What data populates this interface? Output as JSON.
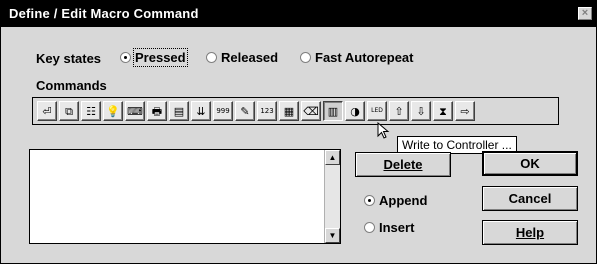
{
  "window": {
    "title": "Define / Edit Macro Command",
    "close_glyph": "×"
  },
  "key_states": {
    "label": "Key states",
    "options": [
      {
        "label": "Pressed",
        "selected": true
      },
      {
        "label": "Released",
        "selected": false
      },
      {
        "label": "Fast Autorepeat",
        "selected": false
      }
    ]
  },
  "commands": {
    "label": "Commands",
    "toolbar": [
      {
        "icon": "enter-icon",
        "glyph": "⏎"
      },
      {
        "icon": "copy-window-icon",
        "glyph": "⧉"
      },
      {
        "icon": "list-code-icon",
        "glyph": "☷"
      },
      {
        "icon": "light-bulb-icon",
        "glyph": "💡"
      },
      {
        "icon": "keyboard-icon",
        "glyph": "⌨"
      },
      {
        "icon": "printer-icon",
        "glyph": "🖶"
      },
      {
        "icon": "document-icon",
        "glyph": "▤"
      },
      {
        "icon": "sort-list-icon",
        "glyph": "⇊"
      },
      {
        "icon": "counter-999-icon",
        "glyph": "999"
      },
      {
        "icon": "pen-edit-icon",
        "glyph": "✎"
      },
      {
        "icon": "number-123-icon",
        "glyph": "123"
      },
      {
        "icon": "grid-edit-icon",
        "glyph": "▦"
      },
      {
        "icon": "eraser-icon",
        "glyph": "⌫"
      },
      {
        "icon": "write-to-controller-icon",
        "glyph": "▥",
        "pressed": true
      },
      {
        "icon": "display-icon",
        "glyph": "◑"
      },
      {
        "icon": "led-icon",
        "glyph": "LED"
      },
      {
        "icon": "arrow-up-box-icon",
        "glyph": "⇧"
      },
      {
        "icon": "arrow-down-box-icon",
        "glyph": "⇩"
      },
      {
        "icon": "hourglass-icon",
        "glyph": "⧗"
      },
      {
        "icon": "arrow-right-icon",
        "glyph": "⇨"
      }
    ],
    "tooltip": "Write to Controller ..."
  },
  "buttons": {
    "delete": "Delete",
    "ok": "OK",
    "cancel": "Cancel",
    "help": "Help"
  },
  "insert_mode": {
    "options": [
      {
        "label": "Append",
        "selected": true
      },
      {
        "label": "Insert",
        "selected": false
      }
    ]
  }
}
